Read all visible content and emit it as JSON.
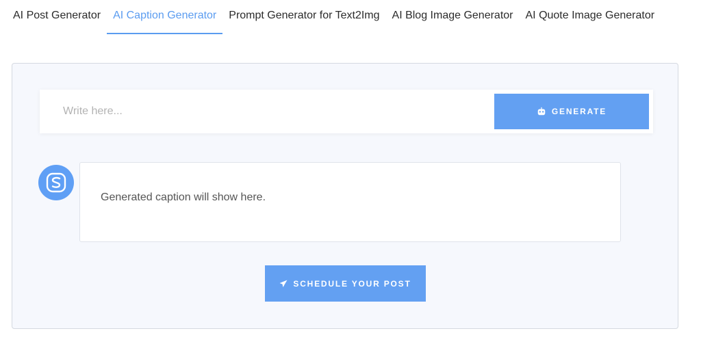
{
  "tabs": [
    {
      "label": "AI Post Generator",
      "active": false
    },
    {
      "label": "AI Caption Generator",
      "active": true
    },
    {
      "label": "Prompt Generator for Text2Img",
      "active": false
    },
    {
      "label": "AI Blog Image Generator",
      "active": false
    },
    {
      "label": "AI Quote Image Generator",
      "active": false
    }
  ],
  "input": {
    "placeholder": "Write here...",
    "value": ""
  },
  "generate_button": {
    "label": "GENERATE",
    "icon": "robot-icon"
  },
  "avatar": {
    "icon": "app-logo-icon"
  },
  "caption": {
    "text": "Generated caption will show here."
  },
  "schedule_button": {
    "label": "SCHEDULE YOUR POST",
    "icon": "paper-plane-icon"
  },
  "colors": {
    "accent": "#63a0f2",
    "panel_bg": "#f6f8fd",
    "text": "#2b2b2b"
  }
}
